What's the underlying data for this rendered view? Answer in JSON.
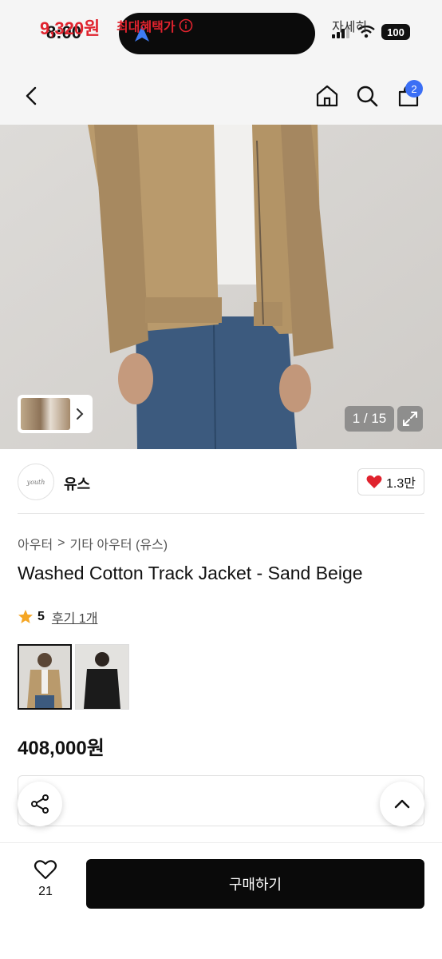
{
  "status_bar": {
    "time": "8:00",
    "battery": "100"
  },
  "nav": {
    "cart_count": "2"
  },
  "gallery": {
    "counter": "1 / 15"
  },
  "brand": {
    "logo_text": "youth",
    "name": "유스",
    "likes": "1.3만"
  },
  "breadcrumb": {
    "category": "아우터",
    "separator": ">",
    "subcategory": "기타 아우터 (유스)"
  },
  "product": {
    "title": "Washed Cotton Track Jacket - Sand Beige",
    "rating": "5",
    "reviews": "후기 1개",
    "price": "408,000원"
  },
  "benefit": {
    "price": "9,320원",
    "label": "최대혜택가",
    "detail": "자세히"
  },
  "bottom": {
    "wish_count": "21",
    "buy_label": "구매하기"
  },
  "colors": {
    "accent_red": "#e0232e",
    "badge_blue": "#3b6ff5",
    "buy_button": "#0a0a0a"
  }
}
